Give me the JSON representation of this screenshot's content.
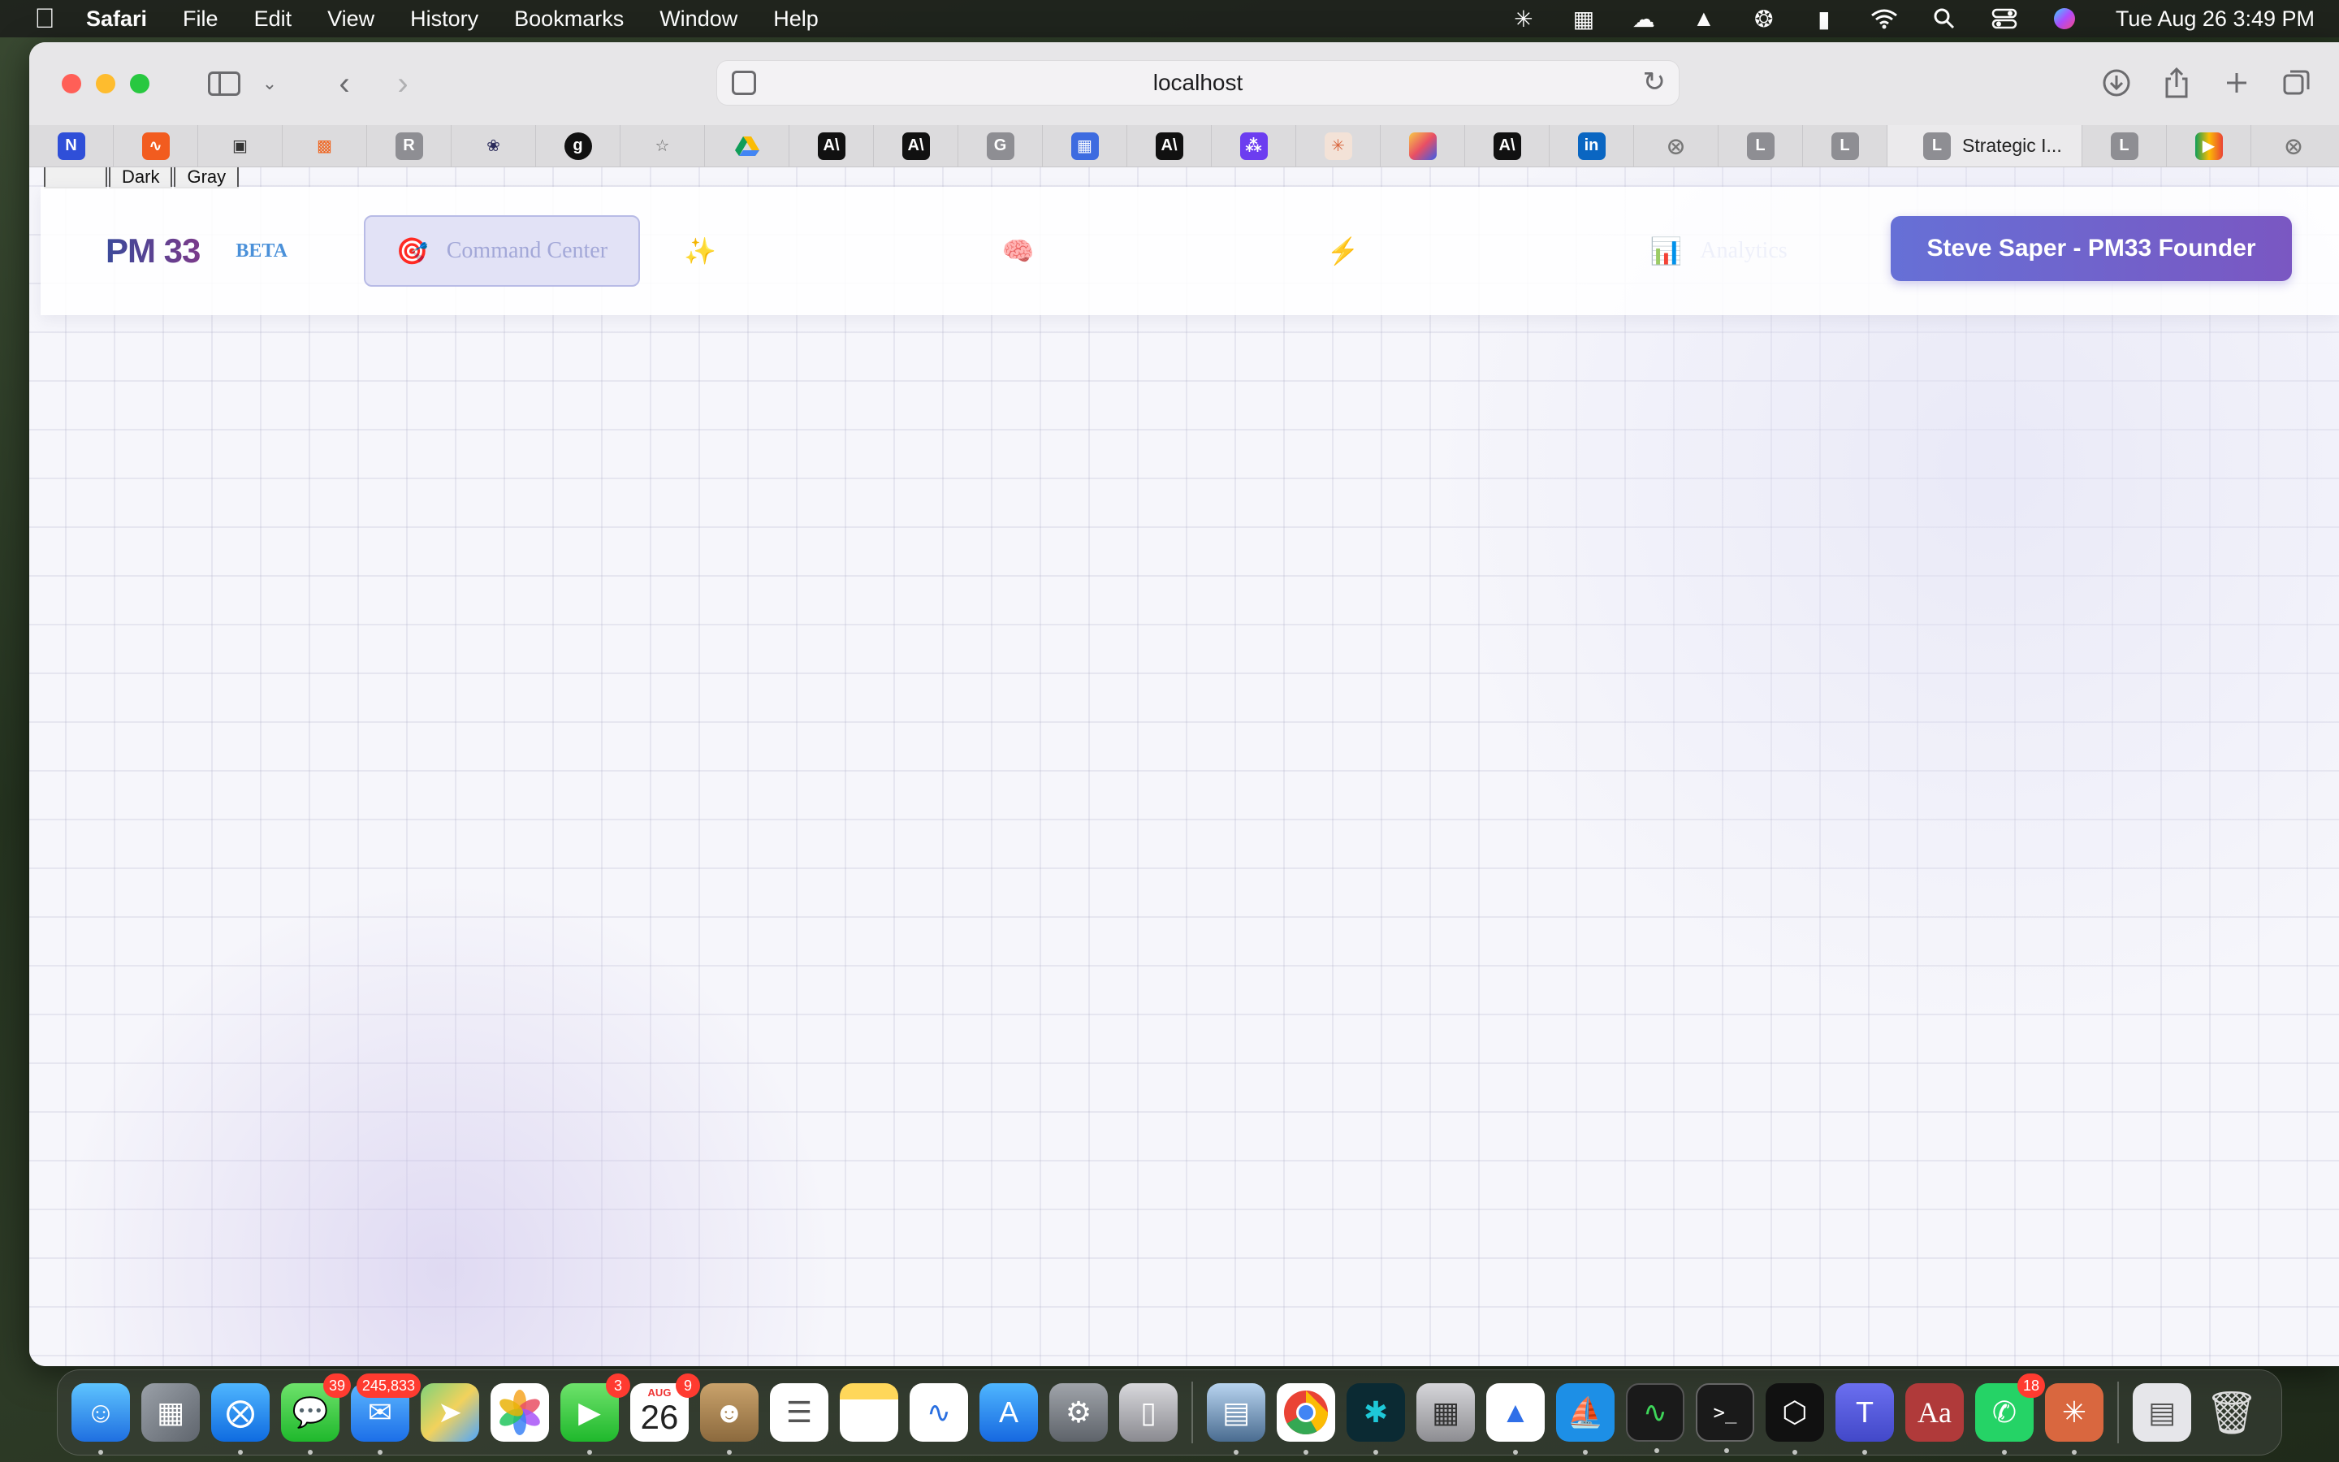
{
  "menubar": {
    "app_name": "Safari",
    "menus": [
      "File",
      "Edit",
      "View",
      "History",
      "Bookmarks",
      "Window",
      "Help"
    ],
    "clock": "Tue Aug 26  3:49 PM"
  },
  "browser": {
    "url": "localhost",
    "active_tab_title": "Strategic I...",
    "tab_letters": [
      "R",
      "G",
      "L",
      "L",
      "L",
      "L"
    ]
  },
  "page": {
    "theme_options": [
      "",
      "Dark",
      "Gray"
    ],
    "logo": "PM 33",
    "beta_label": "BETA",
    "nav": {
      "command_center": "Command Center",
      "tab5_label": "Analytics"
    },
    "cta_label": "Steve Saper - PM33 Founder"
  },
  "dock": {
    "badges": {
      "messages": "39",
      "mail": "245,833",
      "facetime": "3",
      "calendar": "9",
      "whatsapp": "18"
    },
    "calendar_month": "AUG",
    "calendar_day": "26"
  },
  "colors": {
    "accent_start": "#6670d6",
    "accent_end": "#7a57c2",
    "nav_text": "#a3a8d8",
    "beta": "#4a90d9"
  }
}
